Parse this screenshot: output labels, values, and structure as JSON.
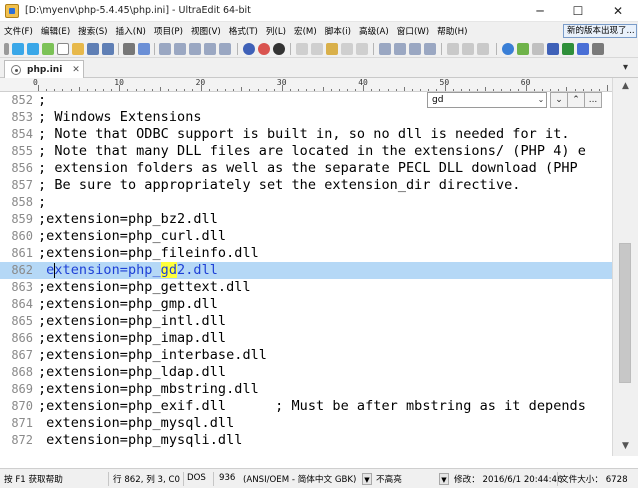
{
  "window": {
    "title": "[D:\\myenv\\php-5.4.45\\php.ini] - UltraEdit 64-bit",
    "minimize": "─",
    "maximize": "☐",
    "close": "✕"
  },
  "menu": [
    "文件(F)",
    "编辑(E)",
    "搜索(S)",
    "插入(N)",
    "项目(P)",
    "视图(V)",
    "格式(T)",
    "列(L)",
    "宏(M)",
    "脚本(i)",
    "高级(A)",
    "窗口(W)",
    "帮助(H)"
  ],
  "update_banner": "新的版本出现了...",
  "tab": {
    "label": "php.ini",
    "close": "✕"
  },
  "ruler": {
    "labels": [
      "0",
      "10",
      "20",
      "30",
      "40",
      "50",
      "60"
    ]
  },
  "find": {
    "value": "gd",
    "dropdown": "⌄",
    "next": "⌄",
    "prev": "⌃",
    "more": "..."
  },
  "editor": {
    "lines": [
      {
        "num": "852",
        "text": ";"
      },
      {
        "num": "853",
        "text": "; Windows Extensions"
      },
      {
        "num": "854",
        "text": "; Note that ODBC support is built in, so no dll is needed for it."
      },
      {
        "num": "855",
        "text": "; Note that many DLL files are located in the extensions/ (PHP 4) e"
      },
      {
        "num": "856",
        "text": "; extension folders as well as the separate PECL DLL download (PHP"
      },
      {
        "num": "857",
        "text": "; Be sure to appropriately set the extension_dir directive."
      },
      {
        "num": "858",
        "text": ";"
      },
      {
        "num": "859",
        "text": ";extension=php_bz2.dll"
      },
      {
        "num": "860",
        "text": ";extension=php_curl.dll"
      },
      {
        "num": "861",
        "text": ";extension=php_fileinfo.dll"
      },
      {
        "num": "862",
        "pre": " extension=php_",
        "match": "gd",
        "post": "2.dll"
      },
      {
        "num": "863",
        "text": ";extension=php_gettext.dll"
      },
      {
        "num": "864",
        "text": ";extension=php_gmp.dll"
      },
      {
        "num": "865",
        "text": ";extension=php_intl.dll"
      },
      {
        "num": "866",
        "text": ";extension=php_imap.dll"
      },
      {
        "num": "867",
        "text": ";extension=php_interbase.dll"
      },
      {
        "num": "868",
        "text": ";extension=php_ldap.dll"
      },
      {
        "num": "869",
        "text": ";extension=php_mbstring.dll"
      },
      {
        "num": "870",
        "text": ";extension=php_exif.dll      ; Must be after mbstring as it depends"
      },
      {
        "num": "871",
        "text": " extension=php_mysql.dll"
      },
      {
        "num": "872",
        "text": " extension=php_mysqli.dll"
      }
    ]
  },
  "status": {
    "help": "按 F1 获取帮助",
    "position": "行 862, 列 3, C0",
    "format": "DOS",
    "codepage": "936",
    "encoding": "(ANSI/OEM - 简体中文 GBK)",
    "highlight": "不高亮",
    "modified": "修改： 2016/6/1 20:44:46",
    "filesize": "文件大小： 6728"
  },
  "colors": {
    "current_line": "#b5d8f6",
    "match": "#ffff3c",
    "current_text": "#1d3fd6"
  }
}
